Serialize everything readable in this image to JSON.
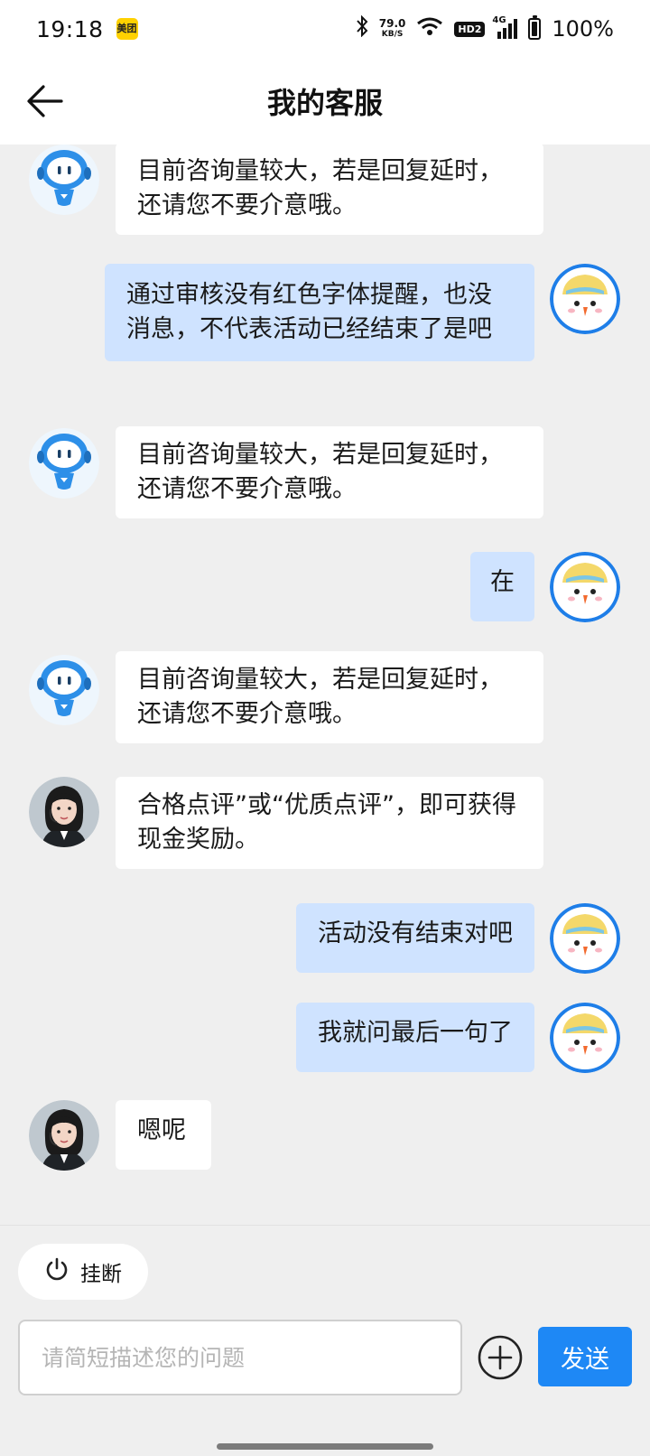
{
  "status_bar": {
    "time": "19:18",
    "app_badge": "美团",
    "net_speed_value": "79.0",
    "net_speed_unit": "KB/S",
    "hd_label": "HD2",
    "signal_label": "4G",
    "battery": "100%"
  },
  "header": {
    "title": "我的客服"
  },
  "messages": [
    {
      "from": "bot",
      "text": "目前咨询量较大，若是回复延时，还请您不要介意哦。"
    },
    {
      "from": "user",
      "text": "通过审核没有红色字体提醒，也没消息，不代表活动已经结束了是吧"
    },
    {
      "from": "bot",
      "text": "目前咨询量较大，若是回复延时，还请您不要介意哦。"
    },
    {
      "from": "user",
      "text": "在"
    },
    {
      "from": "bot",
      "text": "目前咨询量较大，若是回复延时，还请您不要介意哦。"
    },
    {
      "from": "agent",
      "text": "合格点评”或“优质点评”，即可获得现金奖励。"
    },
    {
      "from": "user",
      "text": "活动没有结束对吧"
    },
    {
      "from": "user",
      "text": "我就问最后一句了"
    },
    {
      "from": "agent",
      "text": "嗯呢"
    }
  ],
  "bottom": {
    "hangup_label": "挂断",
    "input_placeholder": "请简短描述您的问题",
    "send_label": "发送"
  },
  "colors": {
    "user_bubble": "#cfe3ff",
    "bot_bubble": "#ffffff",
    "send_button": "#1e88f5",
    "background": "#efefef"
  }
}
